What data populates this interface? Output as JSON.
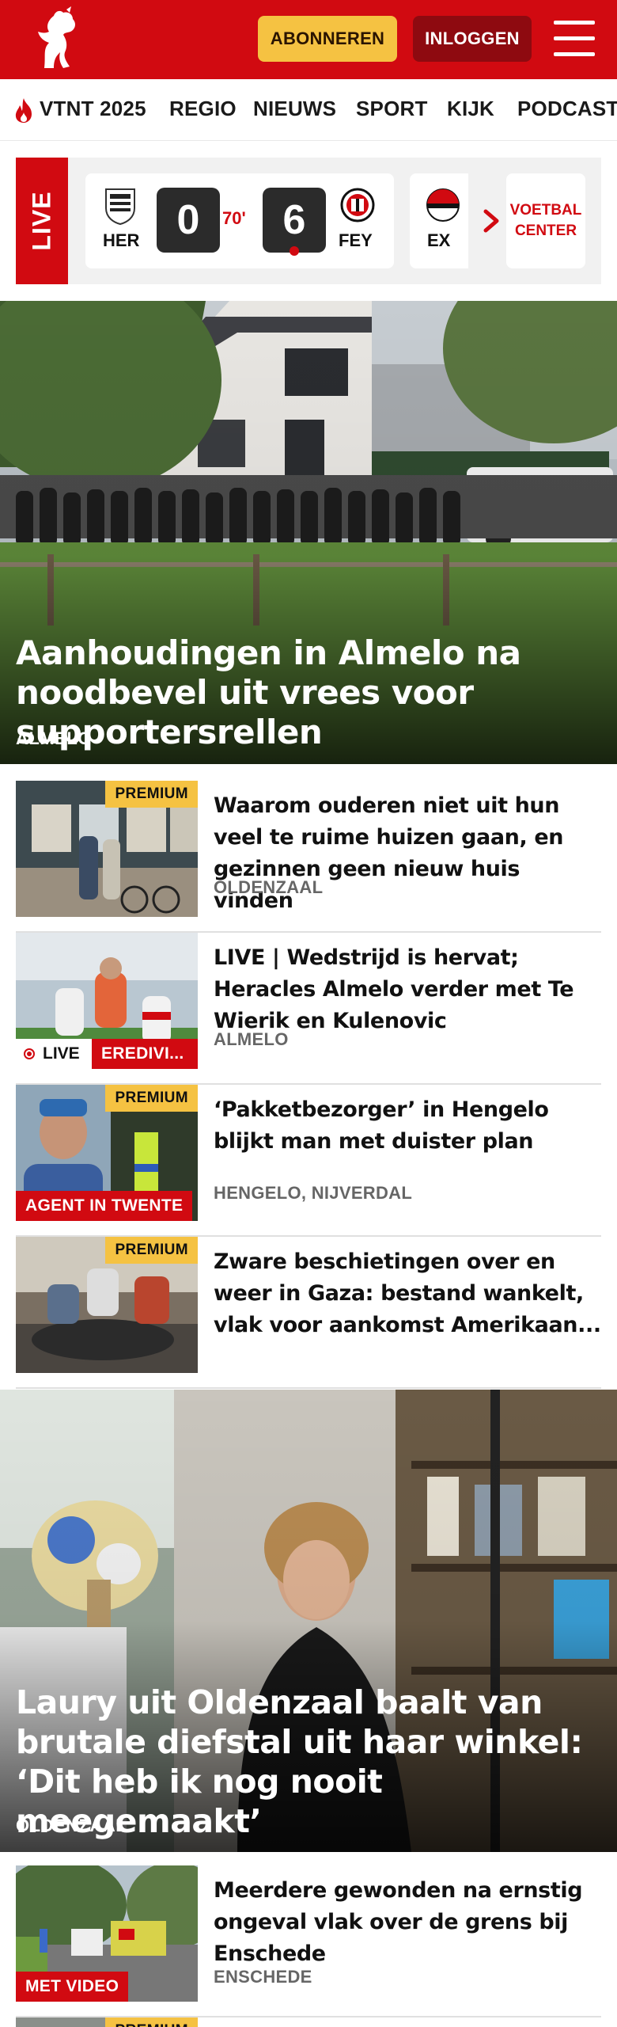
{
  "header": {
    "subscribe_label": "ABONNEREN",
    "login_label": "INLOGGEN",
    "brand_color": "#d10a11"
  },
  "nav": {
    "items": [
      "VTNT 2025",
      "REGIO",
      "NIEUWS",
      "SPORT",
      "KIJK",
      "PODCAST"
    ]
  },
  "live": {
    "tag": "LIVE",
    "match": {
      "home_code": "HER",
      "away_code": "FEY",
      "home_score": "0",
      "away_score": "6",
      "minute": "70'"
    },
    "next_match_code": "EX",
    "voetbal_center_label": "VOETBAL CENTER"
  },
  "hero": {
    "title": "Aanhoudingen in Almelo na noodbevel uit vrees voor supportersrellen",
    "location": "ALMELO"
  },
  "articles": [
    {
      "title": "Waarom ouderen niet uit hun veel te ruime huizen gaan, en gezinnen geen nieuw huis vinden",
      "location": "OLDENZAAL",
      "premium": "PREMIUM"
    },
    {
      "title": "LIVE | Wedstrijd is hervat; Heracles Almelo verder met Te Wierik en Kulenovic",
      "location": "ALMELO",
      "live_label": "LIVE",
      "category": "EREDIVI..."
    },
    {
      "title": "‘Pakketbezorger’ in Hengelo blijkt man met duister plan",
      "location": "HENGELO, NIJVERDAL",
      "premium": "PREMIUM",
      "category": "AGENT IN TWENTE"
    },
    {
      "title": "Zware beschietingen over en weer in Gaza: bestand wankelt, vlak voor aankomst Amerikaan...",
      "location": "",
      "premium": "PREMIUM"
    }
  ],
  "hero2": {
    "title": "Laury uit Oldenzaal baalt van brutale diefstal uit haar winkel: ‘Dit heb ik nog nooit meegemaakt’",
    "location": "OLDENZAAL"
  },
  "articles2": [
    {
      "title": "Meerdere gewonden na ernstig ongeval vlak over de grens bij Enschede",
      "location": "ENSCHEDE",
      "category": "MET VIDEO"
    },
    {
      "premium": "PREMIUM"
    }
  ]
}
